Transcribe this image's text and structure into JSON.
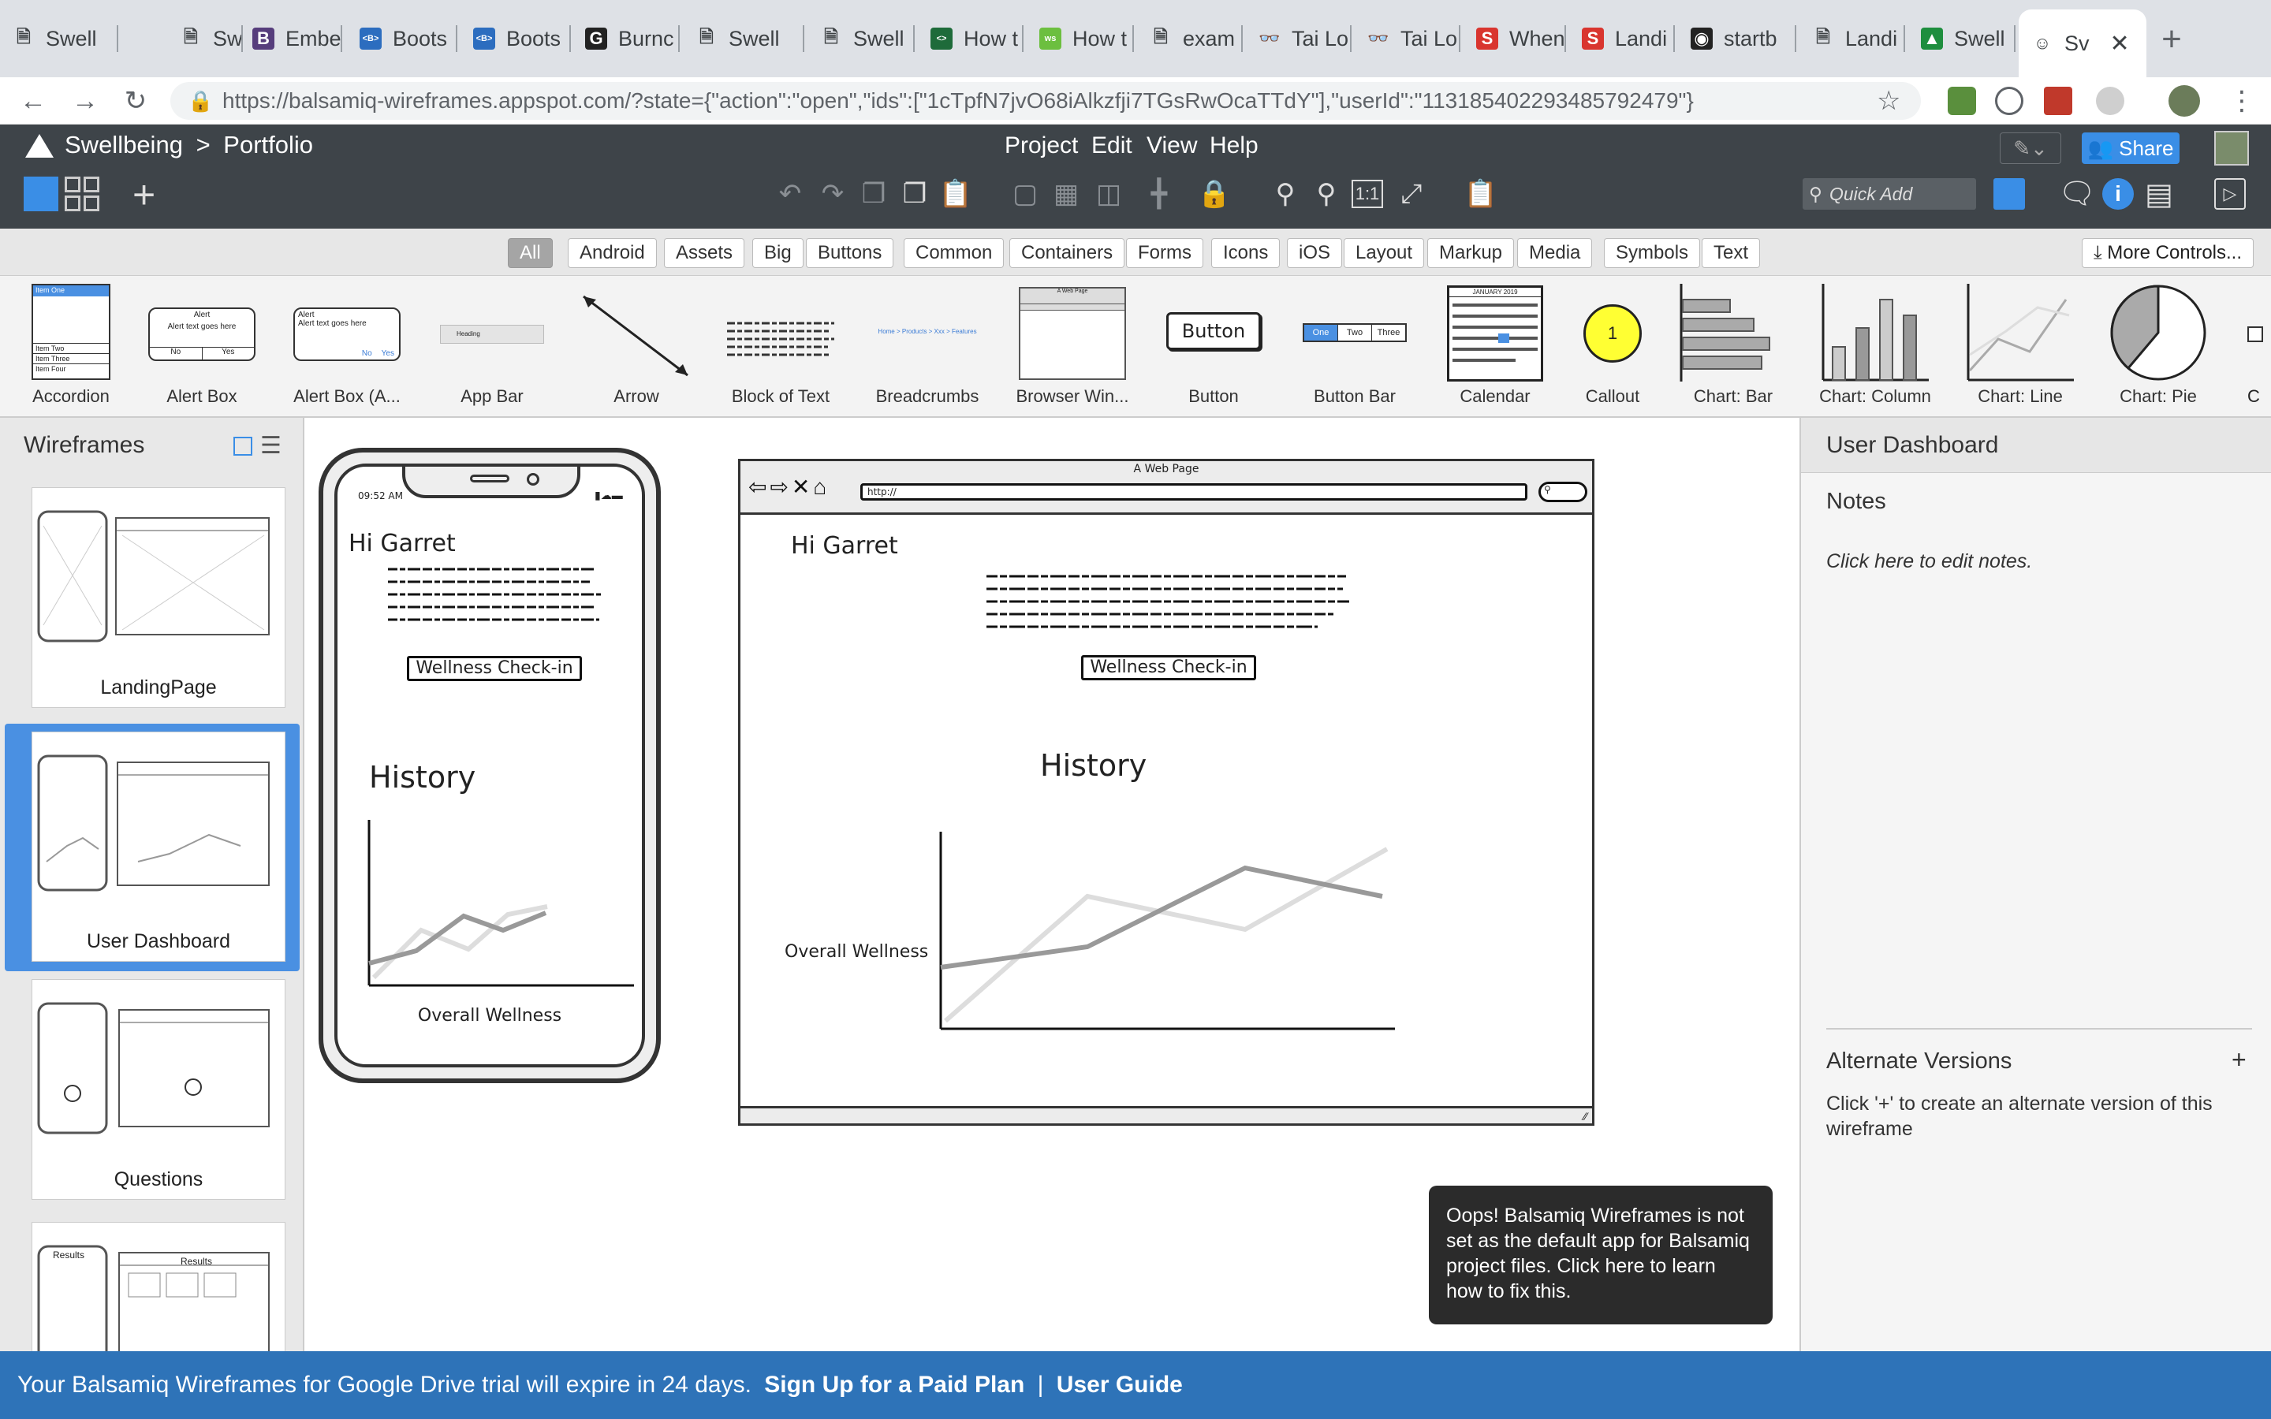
{
  "browser": {
    "tabs": [
      {
        "label": "Swell",
        "fav": "doc-icon"
      },
      {
        "label": "Swell",
        "fav": "doc-icon"
      },
      {
        "label": "Embe",
        "fav": "B"
      },
      {
        "label": "Boots",
        "fav": "<B>"
      },
      {
        "label": "Boots",
        "fav": "<B>"
      },
      {
        "label": "Burnc",
        "fav": "G"
      },
      {
        "label": "Swell",
        "fav": "doc-icon"
      },
      {
        "label": "Swell",
        "fav": "doc-icon"
      },
      {
        "label": "How t",
        "fav": "code"
      },
      {
        "label": "How t",
        "fav": "ws"
      },
      {
        "label": "exam",
        "fav": "doc-icon"
      },
      {
        "label": "Tai Lo",
        "fav": "glasses"
      },
      {
        "label": "Tai Lo",
        "fav": "glasses"
      },
      {
        "label": "When",
        "fav": "S"
      },
      {
        "label": "Landi",
        "fav": "S"
      },
      {
        "label": "startb",
        "fav": "github"
      },
      {
        "label": "Landi",
        "fav": "doc-icon"
      },
      {
        "label": "Swell",
        "fav": "drive"
      },
      {
        "label": "Sv",
        "fav": "smile"
      }
    ],
    "url": "https://balsamiq-wireframes.appspot.com/?state={\"action\":\"open\",\"ids\":[\"1cTpfN7jvO68iAlkzfji7TGsRwOcaTTdY\"],\"userId\":\"113185402293485792479\"}"
  },
  "app": {
    "breadcrumb_project": "Swellbeing",
    "breadcrumb_sep": ">",
    "breadcrumb_page": "Portfolio",
    "menus": [
      "Project",
      "Edit",
      "View",
      "Help"
    ],
    "share_label": "Share",
    "quick_add_placeholder": "Quick Add"
  },
  "categories": [
    "All",
    "Android",
    "Assets",
    "Big",
    "Buttons",
    "Common",
    "Containers",
    "Forms",
    "Icons",
    "iOS",
    "Layout",
    "Markup",
    "Media",
    "Symbols",
    "Text"
  ],
  "more_controls": "More Controls...",
  "ui_library": [
    "Accordion",
    "Alert Box",
    "Alert Box (A...",
    "App Bar",
    "Arrow",
    "Block of Text",
    "Breadcrumbs",
    "Browser Win...",
    "Button",
    "Button Bar",
    "Calendar",
    "Callout",
    "Chart: Bar",
    "Chart: Column",
    "Chart: Line",
    "Chart: Pie",
    "C"
  ],
  "thumb_text": {
    "accordion_items": [
      "Item One",
      "Item Two",
      "Item Three",
      "Item Four"
    ],
    "alert_title": "Alert",
    "alert_body": "Alert text goes here",
    "alert_no": "No",
    "alert_yes": "Yes",
    "appbar_heading": "Heading",
    "breadcrumbs": "Home > Products > Xxx > Features",
    "browser_title": "A Web Page",
    "button_label": "Button",
    "button_bar": [
      "One",
      "Two",
      "Three"
    ],
    "calendar_month": "JANUARY 2019",
    "callout_num": "1"
  },
  "wireframes_panel": {
    "title": "Wireframes",
    "pages": [
      "LandingPage",
      "User Dashboard",
      "Questions",
      "Results"
    ]
  },
  "mockup": {
    "phone_time": "09:52 AM",
    "greeting": "Hi Garret",
    "checkin_button": "Wellness Check-in",
    "history_title": "History",
    "chart_label": "Overall Wellness",
    "browser_title": "A Web Page",
    "browser_url": "http://"
  },
  "right_panel": {
    "title": "User Dashboard",
    "notes_title": "Notes",
    "notes_hint": "Click here to edit notes.",
    "alt_title": "Alternate Versions",
    "alt_add": "+",
    "alt_hint": "Click '+' to create an alternate version of this wireframe"
  },
  "toast": "Oops! Balsamiq Wireframes is not set as the default app for Balsamiq project files. Click here to learn how to fix this.",
  "footer": {
    "trial_text": "Your Balsamiq Wireframes for Google Drive trial will expire in 24 days.",
    "signup_link": "Sign Up for a Paid Plan",
    "divider": "|",
    "guide_link": "User Guide"
  }
}
